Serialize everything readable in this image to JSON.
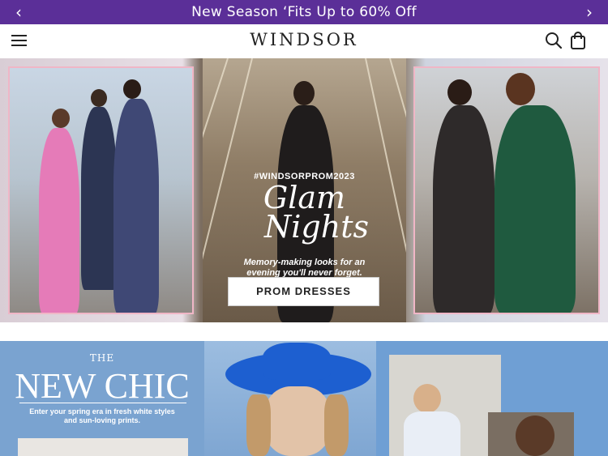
{
  "promo": {
    "text": "New Season ‘Fits Up to 60% Off",
    "prev_icon": "chevron-left-icon",
    "next_icon": "chevron-right-icon"
  },
  "header": {
    "logo": "WINDSOR",
    "menu_icon": "hamburger-menu-icon",
    "search_icon": "search-icon",
    "bag_icon": "shopping-bag-icon"
  },
  "hero": {
    "hashtag": "#WINDSORPROM2023",
    "script_line1": "Glam",
    "script_line2": "Nights",
    "tagline": "Memory-making looks for an evening you'll never forget.",
    "cta_label": "PROM DRESSES"
  },
  "banner2": {
    "eyebrow": "THE",
    "title": "NEW CHIC",
    "subtitle": "Enter your spring era in fresh white styles and sun-loving prints."
  },
  "colors": {
    "promo_bg": "#5b2f98",
    "banner2_bg": "#7fa6d2",
    "accent_pink": "#f0b6c6"
  }
}
